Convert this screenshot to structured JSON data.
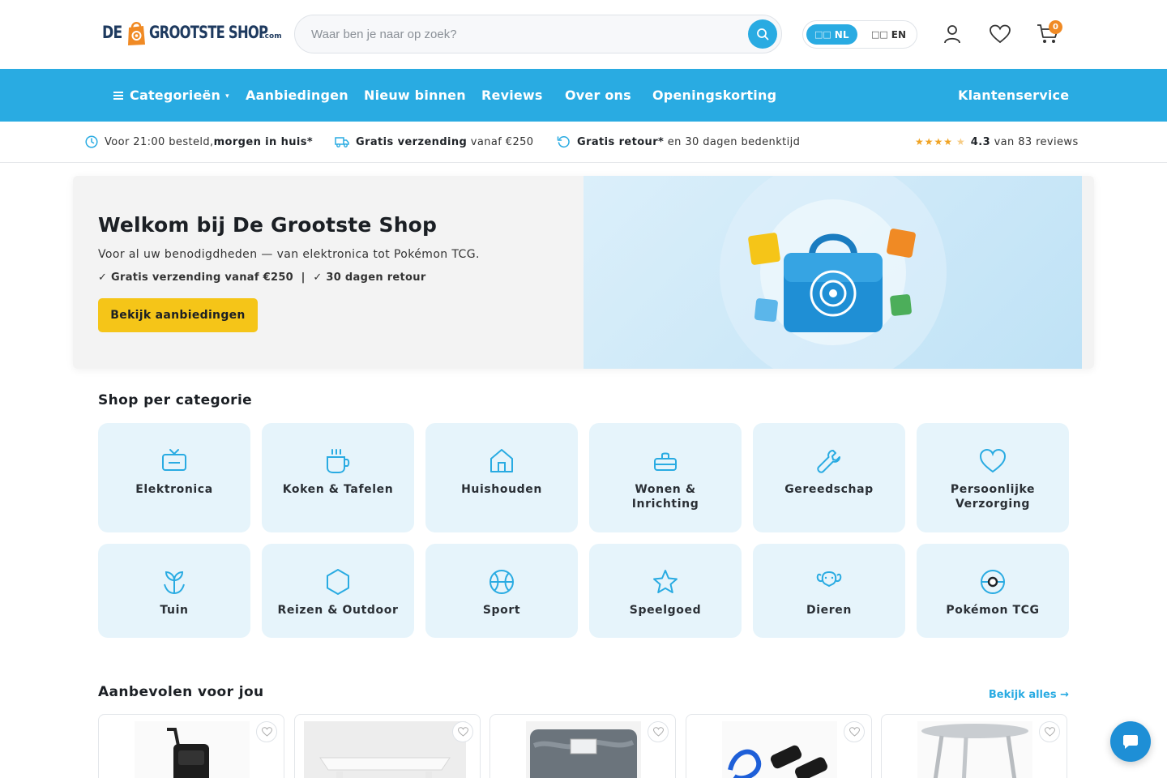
{
  "header": {
    "logo": {
      "part1": "DE",
      "part2": "GROOTSTE SHOP",
      "part3": ".com"
    },
    "search": {
      "placeholder": "Waar ben je naar op zoek?",
      "value": ""
    },
    "language": {
      "options": [
        {
          "flag": "□□",
          "code": "NL",
          "selected": true
        },
        {
          "flag": "□□",
          "code": "EN",
          "selected": false
        }
      ]
    },
    "cart_count": "0",
    "icons": [
      "search-icon",
      "user-icon",
      "heart-icon",
      "cart-icon"
    ],
    "accent_color": "#29abe2",
    "badge_color": "#f08a24"
  },
  "nav": {
    "items": [
      "Categorieën",
      "Aanbiedingen",
      "Nieuw binnen",
      "Reviews",
      "Over ons",
      "Openingskorting"
    ],
    "right": "Klantenservice",
    "categories_caret": "▾"
  },
  "usp": {
    "delivery": {
      "pre": "Voor 21:00 besteld,",
      "bold": "morgen in huis*"
    },
    "shipping": {
      "bold": "Gratis verzending",
      "post": " vanaf €250"
    },
    "returns": {
      "bold": "Gratis retour*",
      "post": " en 30 dagen bedenktijd"
    },
    "reviews": {
      "stars": "★★★★",
      "half": "★",
      "rating": "4.3",
      "text": " van 83 reviews",
      "rating_value": 4.3
    }
  },
  "hero": {
    "title": "Welkom bij De Grootste Shop",
    "subtitle": "Voor al uw benodigdheden — van elektronica tot Pokémon TCG.",
    "perks": "✓ Gratis verzending vanaf €250  |  ✓ 30 dagen retour",
    "cta": "Bekijk aanbiedingen",
    "cta_color": "#f5c518"
  },
  "categories": {
    "title": "Shop per categorie",
    "items": [
      {
        "label": "Elektronica",
        "icon": "tv-icon"
      },
      {
        "label": "Koken & Tafelen",
        "icon": "cup-icon"
      },
      {
        "label": "Huishouden",
        "icon": "house-icon"
      },
      {
        "label": "Wonen & Inrichting",
        "icon": "sofa-icon"
      },
      {
        "label": "Gereedschap",
        "icon": "wrench-icon"
      },
      {
        "label": "Persoonlijke Verzorging",
        "icon": "heart-icon"
      },
      {
        "label": "Tuin",
        "icon": "sprout-icon"
      },
      {
        "label": "Reizen & Outdoor",
        "icon": "hexagon-icon"
      },
      {
        "label": "Sport",
        "icon": "basketball-icon"
      },
      {
        "label": "Speelgoed",
        "icon": "star-icon"
      },
      {
        "label": "Dieren",
        "icon": "paw-icon"
      },
      {
        "label": "Pokémon TCG",
        "icon": "pokeball-icon"
      }
    ]
  },
  "recommended": {
    "title": "Aanbevolen voor jou",
    "see_all": "Bekijk alles →",
    "products": [
      {
        "image": "shopping-trolley"
      },
      {
        "image": "white-tray-table"
      },
      {
        "image": "grey-fleece-blanket"
      },
      {
        "image": "resistance-bands"
      },
      {
        "image": "grey-side-table"
      }
    ]
  }
}
